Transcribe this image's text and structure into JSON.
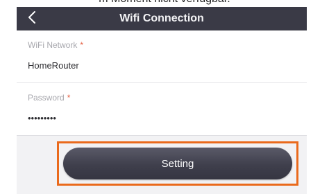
{
  "caption": {
    "text": "m Moment nicht verfügbar."
  },
  "navbar": {
    "back_icon": "chevron-left-icon",
    "title": "Wifi Connection",
    "background": "#3a3a46"
  },
  "form": {
    "network": {
      "label": "WiFi Network",
      "required_mark": "*",
      "value": "HomeRouter"
    },
    "password": {
      "label": "Password",
      "required_mark": "*",
      "value": "•••••••••"
    }
  },
  "actions": {
    "setting_label": "Setting",
    "highlight_color": "#ea6a1c"
  }
}
